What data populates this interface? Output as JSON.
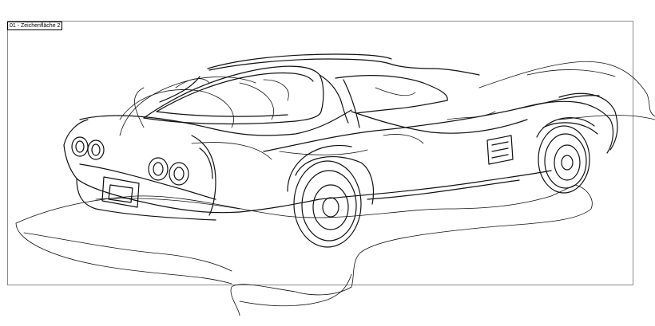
{
  "artboard": {
    "label": "01 - Zeichenfläche 2"
  },
  "illustration": {
    "icon": "car-line-drawing",
    "stroke_color": "#111111",
    "frame_color": "#8a8a8a"
  }
}
